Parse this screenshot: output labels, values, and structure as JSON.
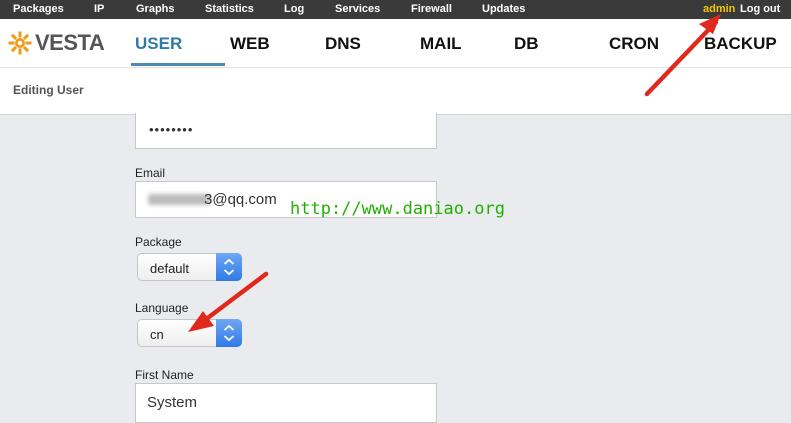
{
  "topbar": {
    "menu": [
      "Packages",
      "IP",
      "Graphs",
      "Statistics",
      "Log",
      "Services",
      "Firewall",
      "Updates"
    ],
    "user": "admin",
    "logout": "Log out"
  },
  "logo": {
    "text": "VESTA"
  },
  "tabs": [
    "USER",
    "WEB",
    "DNS",
    "MAIL",
    "DB",
    "CRON",
    "BACKUP"
  ],
  "active_tab": "USER",
  "page": {
    "title": "Editing User"
  },
  "form": {
    "password": {
      "value": "••••••••"
    },
    "email": {
      "label": "Email",
      "value": "3@qq.com"
    },
    "package": {
      "label": "Package",
      "value": "default"
    },
    "language": {
      "label": "Language",
      "value": "cn"
    },
    "first_name": {
      "label": "First Name",
      "value": "System"
    }
  },
  "watermark": "http://www.daniao.org",
  "colors": {
    "accent": "#2f7aa5",
    "user": "#f5c400",
    "watermark": "#21b000",
    "arrow": "#e0291c"
  }
}
